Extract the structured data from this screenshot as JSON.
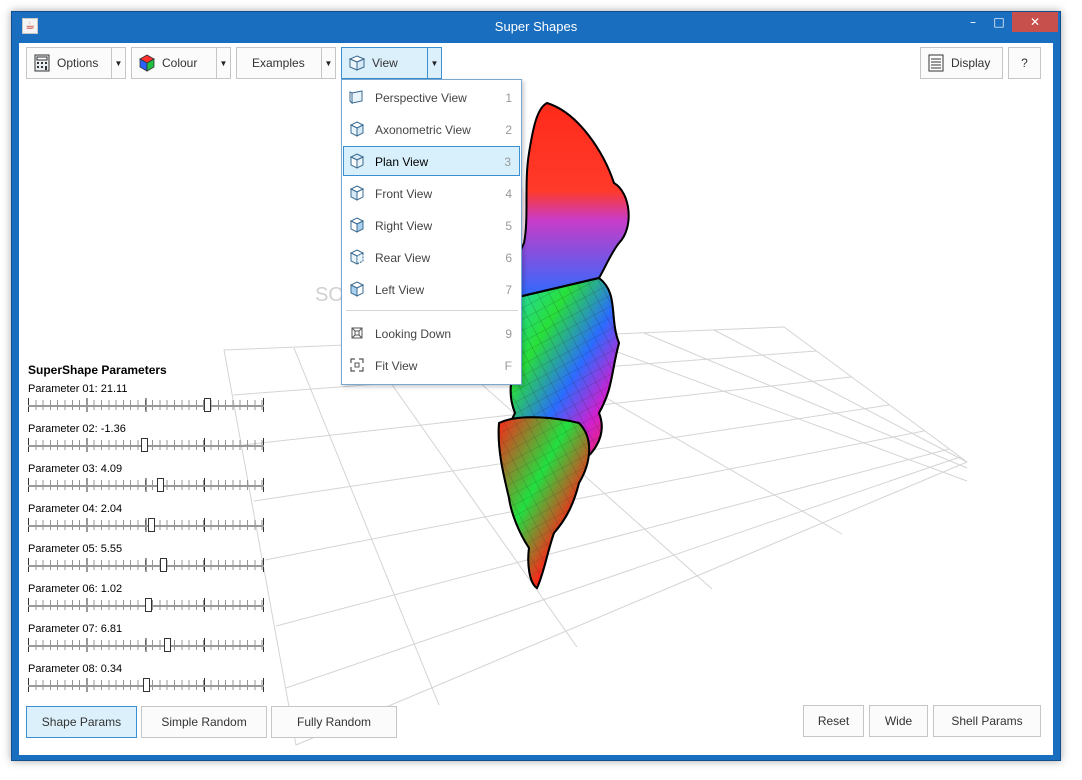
{
  "window": {
    "title": "Super Shapes",
    "app_icon": "java-icon",
    "minimize": "–",
    "maximize": "□",
    "close": "✕"
  },
  "toolbar": {
    "options_label": "Options",
    "colour_label": "Colour",
    "examples_label": "Examples",
    "view_label": "View",
    "display_label": "Display",
    "help_label": "?",
    "dropdown_arrow": "▼"
  },
  "view_menu": {
    "items": [
      {
        "label": "Perspective View",
        "key": "1",
        "icon": "perspective-cube-icon"
      },
      {
        "label": "Axonometric View",
        "key": "2",
        "icon": "axonometric-cube-icon"
      },
      {
        "label": "Plan View",
        "key": "3",
        "icon": "plan-cube-icon",
        "selected": true
      },
      {
        "label": "Front View",
        "key": "4",
        "icon": "front-cube-icon"
      },
      {
        "label": "Right View",
        "key": "5",
        "icon": "right-cube-icon"
      },
      {
        "label": "Rear View",
        "key": "6",
        "icon": "rear-cube-icon"
      },
      {
        "label": "Left View",
        "key": "7",
        "icon": "left-cube-icon"
      },
      {
        "label": "Looking Down",
        "key": "9",
        "icon": "looking-down-icon"
      },
      {
        "label": "Fit View",
        "key": "F",
        "icon": "fit-view-icon"
      }
    ]
  },
  "parameters": {
    "title": "SuperShape Parameters",
    "items": [
      {
        "label": "Parameter 01: 21.11",
        "position": 0.76
      },
      {
        "label": "Parameter 02: -1.36",
        "position": 0.49
      },
      {
        "label": "Parameter 03: 4.09",
        "position": 0.56
      },
      {
        "label": "Parameter 04: 2.04",
        "position": 0.52
      },
      {
        "label": "Parameter 05: 5.55",
        "position": 0.57
      },
      {
        "label": "Parameter 06: 1.02",
        "position": 0.51
      },
      {
        "label": "Parameter 07: 6.81",
        "position": 0.59
      },
      {
        "label": "Parameter 08: 0.34",
        "position": 0.5
      }
    ]
  },
  "bottom": {
    "shape_params": "Shape Params",
    "simple_random": "Simple Random",
    "fully_random": "Fully Random",
    "reset": "Reset",
    "wide": "Wide",
    "shell_params": "Shell Params"
  },
  "watermark": "SOFTPEDIA",
  "colors": {
    "titlebar": "#1a6ec0",
    "accent": "#3c8fd0",
    "selected_bg": "#d8f0fb"
  }
}
